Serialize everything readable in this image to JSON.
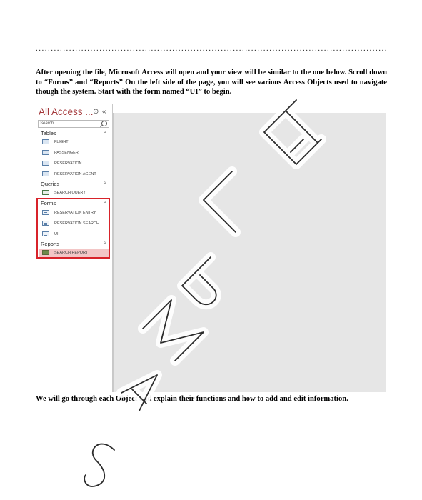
{
  "separator": "............................................................................................................................................................",
  "intro_text": "After opening the file, Microsoft Access will open and your view will be similar to the one below. Scroll down to “Forms” and “Reports” On the left side of the page, you will see various Access Objects used to navigate though the system. Start with the form named “UI” to begin.",
  "nav": {
    "title": "All Access ...",
    "search_placeholder": "Search...",
    "groups": [
      {
        "label": "Tables",
        "items": [
          "FLIGHT",
          "PASSENGER",
          "RESERVATION",
          "RESERVATION AGENT"
        ]
      },
      {
        "label": "Queries",
        "items": [
          "SEARCH QUERY"
        ]
      },
      {
        "label": "Forms",
        "items": [
          "RESERVATION ENTRY",
          "RESERVATION SEARCH",
          "UI"
        ]
      },
      {
        "label": "Reports",
        "items": [
          "SEARCH REPORT"
        ]
      }
    ]
  },
  "outro_text": "We will go through each Object and explain their functions and how to add and edit information.",
  "colors": {
    "nav_title": "#a4373a",
    "highlight_box": "#d8232a",
    "selected_row": "#f3c6c6",
    "workspace": "#e6e6e6"
  }
}
